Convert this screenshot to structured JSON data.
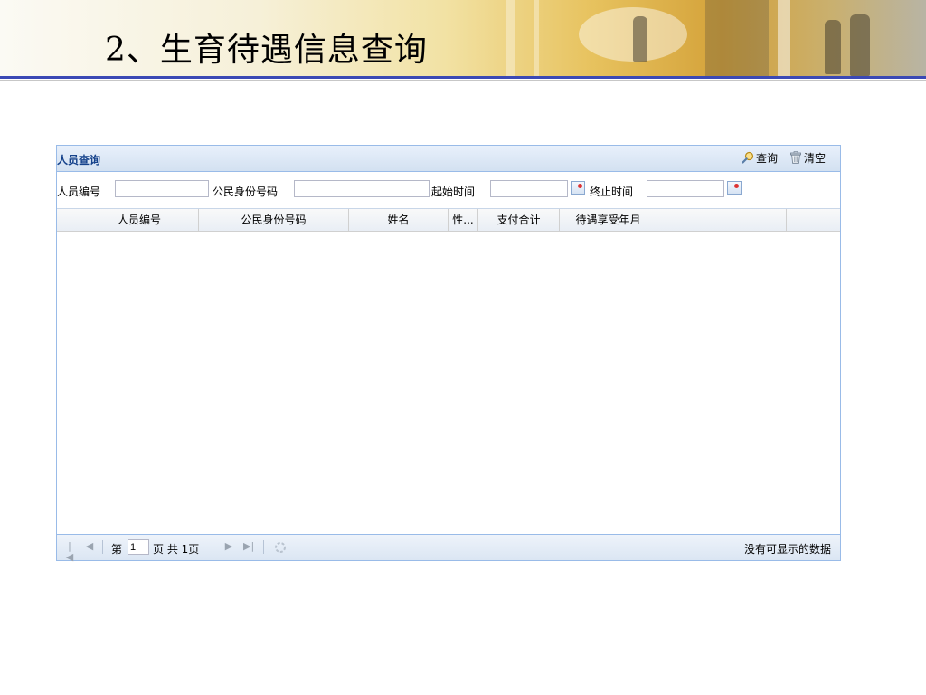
{
  "slide": {
    "title": "2、生育待遇信息查询"
  },
  "panel": {
    "title": "人员查询",
    "buttons": {
      "query": "查询",
      "clear": "清空"
    }
  },
  "form": {
    "person_id_label": "人员编号",
    "person_id_value": "",
    "citizen_id_label": "公民身份号码",
    "citizen_id_value": "",
    "start_time_label": "起始时间",
    "start_time_value": "",
    "end_time_label": "终止时间",
    "end_time_value": ""
  },
  "grid": {
    "columns": [
      "人员编号",
      "公民身份号码",
      "姓名",
      "性...",
      "支付合计",
      "待遇享受年月"
    ],
    "rows": []
  },
  "pager": {
    "page_prefix": "第",
    "current_page": "1",
    "page_suffix": "页 共 1页",
    "empty_message": "没有可显示的数据"
  }
}
